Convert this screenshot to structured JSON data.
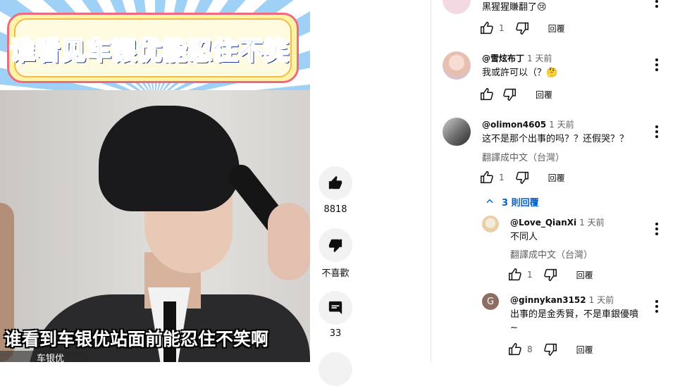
{
  "video": {
    "banner_title": "谁看见车银优能忍住不笑",
    "subtitle": "谁看到车银优站面前能忍住不笑啊",
    "author_tag": "车银优"
  },
  "actions": {
    "like_count": "8818",
    "dislike_label": "不喜歡",
    "comment_count": "33"
  },
  "comments": [
    {
      "text": "黑猩猩賺翻了😢",
      "likes": "1",
      "reply_label": "回覆"
    },
    {
      "handle": "@雪炫布丁",
      "time": "1 天前",
      "text": "我或許可以（？🤔",
      "likes": "",
      "reply_label": "回覆"
    },
    {
      "handle": "@olimon4605",
      "time": "1 天前",
      "text": "这不是那个出事的吗？？还假哭？？",
      "translate": "翻譯成中文（台灣）",
      "likes": "1",
      "reply_label": "回覆",
      "replies_toggle": "3 則回覆"
    }
  ],
  "replies": [
    {
      "handle": "@Love_QianXi",
      "time": "1 天前",
      "text": "不同人",
      "translate": "翻譯成中文（台灣）",
      "likes": "1",
      "reply_label": "回覆"
    },
    {
      "avatar_letter": "G",
      "handle": "@ginnykan3152",
      "time": "1 天前",
      "text": "出事的是金秀賢，不是車銀優噴~",
      "likes": "8",
      "reply_label": "回覆"
    }
  ],
  "colors": {
    "link_blue": "#065fd4",
    "avatar_g_bg": "#8d6e63"
  }
}
